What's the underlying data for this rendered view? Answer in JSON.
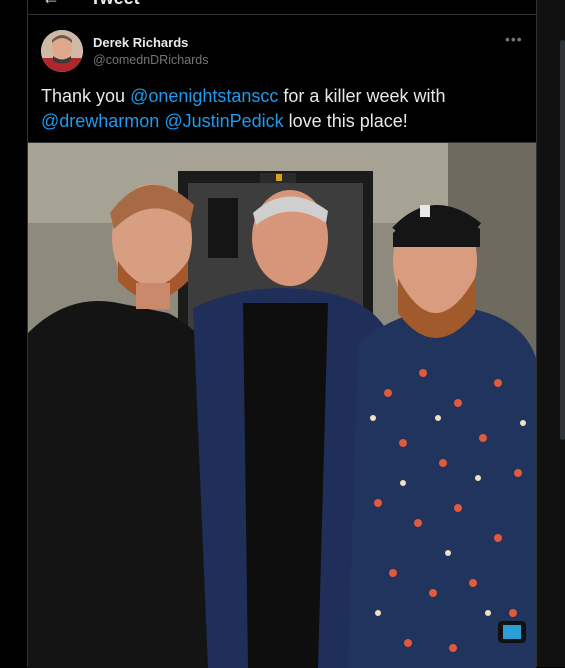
{
  "header": {
    "back_icon": "arrow-left-icon",
    "title": "Tweet"
  },
  "author": {
    "name": "Derek Richards",
    "handle": "@comednDRichards",
    "more_icon": "more-horizontal-icon"
  },
  "tweet": {
    "text_1": "Thank you ",
    "mention_1": "@onenightstanscc",
    "text_2": " for a killer week with ",
    "mention_2": "@drewharmon",
    "text_3": " ",
    "mention_3": "@JustinPedick",
    "text_4": " love this place!"
  },
  "colors": {
    "background": "#000000",
    "text": "#e7e9ea",
    "link": "#1d9bf0",
    "muted": "#71767b",
    "border": "#2f3336"
  }
}
